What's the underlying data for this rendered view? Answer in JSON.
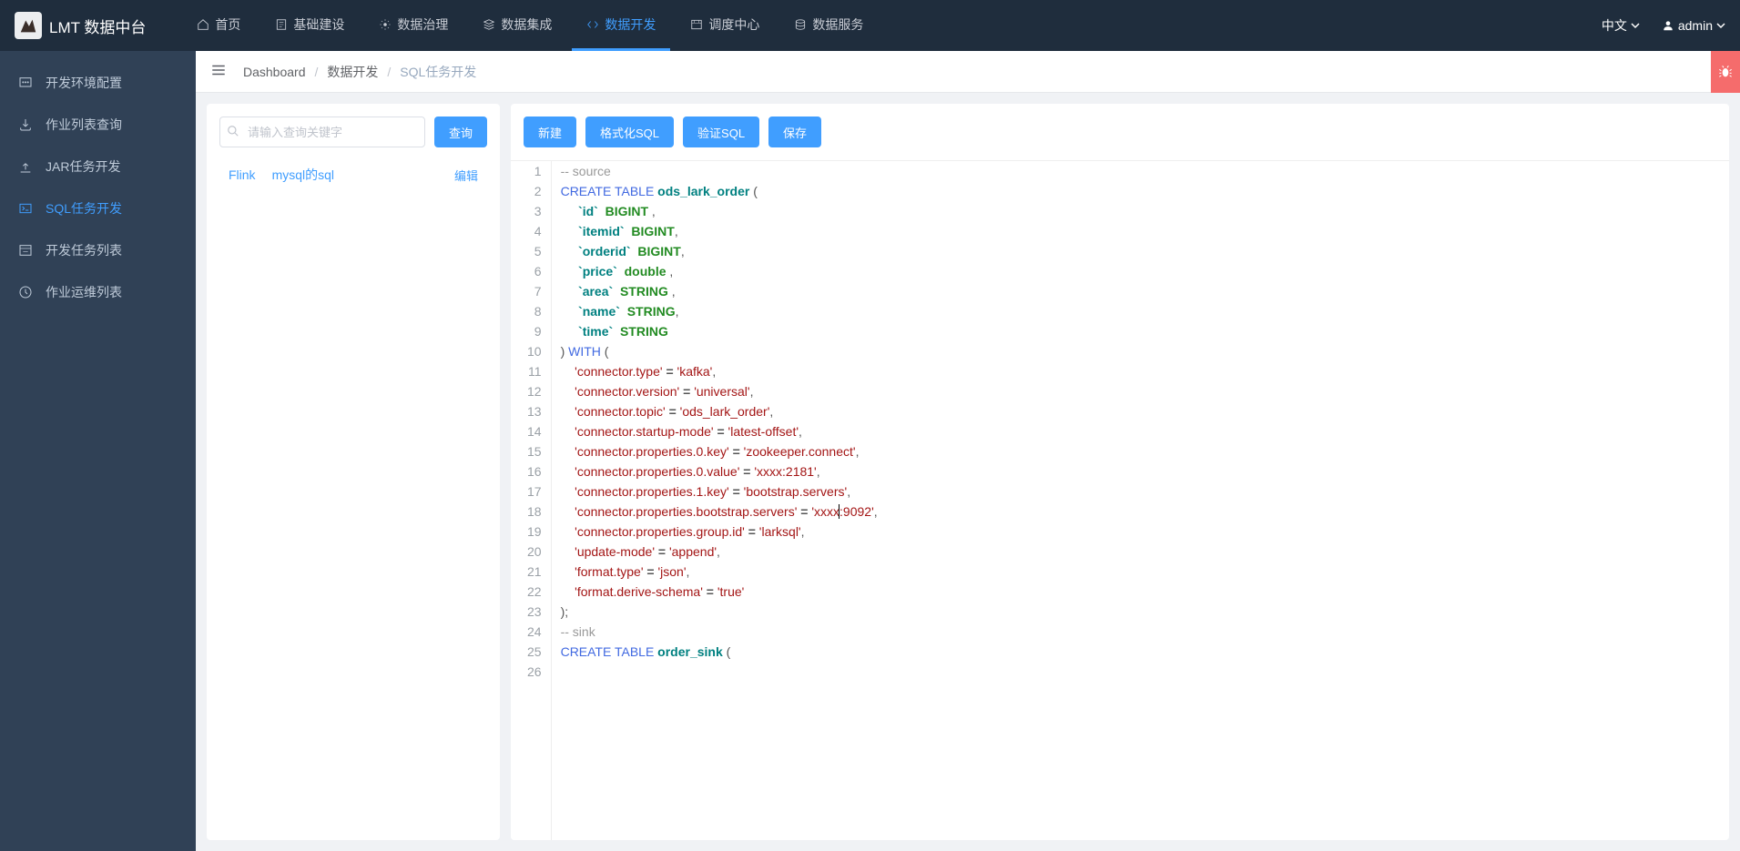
{
  "brand": {
    "title": "LMT 数据中台"
  },
  "nav": {
    "items": [
      {
        "label": "首页",
        "active": false
      },
      {
        "label": "基础建设",
        "active": false
      },
      {
        "label": "数据治理",
        "active": false
      },
      {
        "label": "数据集成",
        "active": false
      },
      {
        "label": "数据开发",
        "active": true
      },
      {
        "label": "调度中心",
        "active": false
      },
      {
        "label": "数据服务",
        "active": false
      }
    ],
    "lang": "中文",
    "user": "admin"
  },
  "sidebar": {
    "items": [
      {
        "label": "开发环境配置",
        "active": false
      },
      {
        "label": "作业列表查询",
        "active": false
      },
      {
        "label": "JAR任务开发",
        "active": false
      },
      {
        "label": "SQL任务开发",
        "active": true
      },
      {
        "label": "开发任务列表",
        "active": false
      },
      {
        "label": "作业运维列表",
        "active": false
      }
    ]
  },
  "breadcrumb": {
    "items": [
      "Dashboard",
      "数据开发",
      "SQL任务开发"
    ]
  },
  "leftPane": {
    "search_placeholder": "请输入查询关键字",
    "query_btn": "查询",
    "task": {
      "engine": "Flink",
      "name": "mysql的sql",
      "edit": "编辑"
    }
  },
  "toolbar": {
    "new": "新建",
    "format": "格式化SQL",
    "validate": "验证SQL",
    "save": "保存"
  },
  "code": {
    "lines": [
      {
        "t": "cmt",
        "raw": "-- source"
      },
      {
        "t": "ctbl",
        "kw1": "CREATE",
        "kw2": "TABLE",
        "name": "ods_lark_order",
        "tail": " ("
      },
      {
        "t": "col",
        "col": "id",
        "type": "BIGINT",
        "tail": " ,"
      },
      {
        "t": "col",
        "col": "itemid",
        "type": "BIGINT",
        "tail": ","
      },
      {
        "t": "col",
        "col": "orderid",
        "type": "BIGINT",
        "tail": ","
      },
      {
        "t": "col",
        "col": "price",
        "type": "double",
        "tail": " ,"
      },
      {
        "t": "col",
        "col": "area",
        "type": "STRING",
        "tail": " ,"
      },
      {
        "t": "col",
        "col": "name",
        "type": "STRING",
        "tail": ","
      },
      {
        "t": "col",
        "col": "time",
        "type": "STRING",
        "tail": ""
      },
      {
        "t": "with"
      },
      {
        "t": "prop",
        "k": "connector.type",
        "v": "kafka",
        "tail": ","
      },
      {
        "t": "prop",
        "k": "connector.version",
        "v": "universal",
        "tail": ","
      },
      {
        "t": "prop",
        "k": "connector.topic",
        "v": "ods_lark_order",
        "tail": ","
      },
      {
        "t": "prop",
        "k": "connector.startup-mode",
        "v": "latest-offset",
        "tail": ","
      },
      {
        "t": "prop",
        "k": "connector.properties.0.key",
        "v": "zookeeper.connect",
        "tail": ","
      },
      {
        "t": "prop",
        "k": "connector.properties.0.value",
        "v": "xxxx:2181",
        "tail": ","
      },
      {
        "t": "prop",
        "k": "connector.properties.1.key",
        "v": "bootstrap.servers",
        "tail": ","
      },
      {
        "t": "propc",
        "k": "connector.properties.bootstrap.servers",
        "v1": "xxxx",
        "v2": ":9092",
        "tail": ","
      },
      {
        "t": "prop",
        "k": "connector.properties.group.id",
        "v": "larksql",
        "tail": ","
      },
      {
        "t": "prop",
        "k": "update-mode",
        "v": "append",
        "tail": ","
      },
      {
        "t": "prop",
        "k": "format.type",
        "v": "json",
        "tail": ","
      },
      {
        "t": "prop",
        "k": "format.derive-schema",
        "v": "true",
        "tail": ""
      },
      {
        "t": "raw",
        "raw": ");"
      },
      {
        "t": "raw",
        "raw": ""
      },
      {
        "t": "cmt",
        "raw": "-- sink"
      },
      {
        "t": "ctbl",
        "kw1": "CREATE",
        "kw2": "TABLE",
        "name": "order_sink",
        "tail": " ("
      }
    ]
  }
}
